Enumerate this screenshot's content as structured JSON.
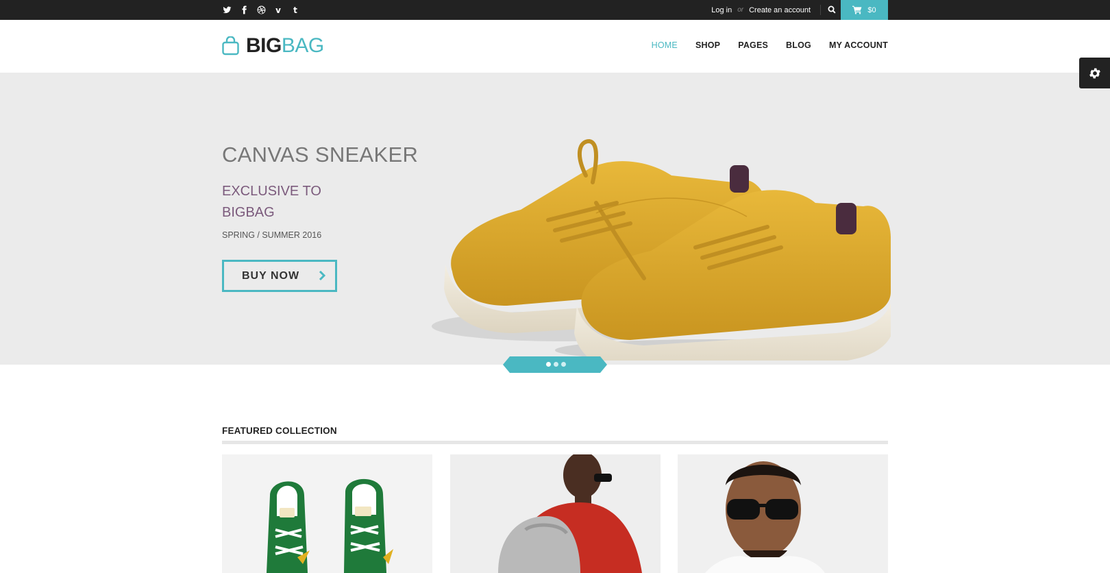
{
  "topbar": {
    "social": [
      {
        "name": "twitter-icon"
      },
      {
        "name": "facebook-icon"
      },
      {
        "name": "dribbble-icon"
      },
      {
        "name": "vimeo-icon",
        "glyph": "v"
      },
      {
        "name": "tumblr-icon",
        "glyph": "t"
      }
    ],
    "login_label": "Log in",
    "or_label": "or",
    "create_label": "Create an account",
    "cart_total": "$0"
  },
  "brand": {
    "big": "BIG",
    "bag": "BAG",
    "accent": "#4ab8c2"
  },
  "nav": {
    "items": [
      "HOME",
      "SHOP",
      "PAGES",
      "BLOG",
      "MY ACCOUNT"
    ],
    "active": "HOME"
  },
  "hero": {
    "title": "CANVAS SNEAKER",
    "subtitle_line1": "EXCLUSIVE TO",
    "subtitle_line2": "BIGBAG",
    "season": "SPRING / SUMMER 2016",
    "button_label": "BUY NOW",
    "slides_total": 3,
    "slide_active": 1
  },
  "featured": {
    "title": "FEATURED COLLECTION"
  },
  "colors": {
    "accent": "#4ab8c2",
    "topbar": "#222222",
    "hero_bg": "#ebebeb",
    "subtitle": "#7b5a7c"
  }
}
